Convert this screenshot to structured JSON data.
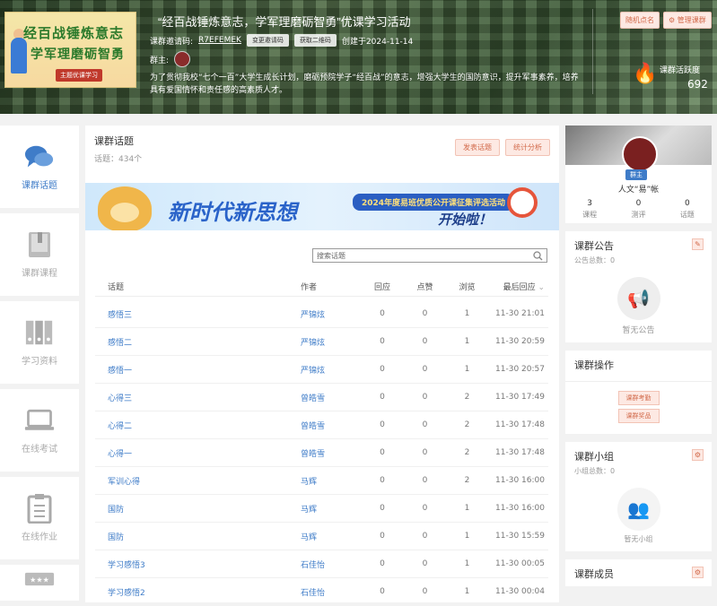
{
  "header": {
    "title": "“经百战锤炼意志，学军理磨砺智勇”优课学习活动",
    "invite_label": "课群邀请码:",
    "invite_code": "R7EFEMEK",
    "change_code_btn": "变更邀请码",
    "qr_btn": "获取二维码",
    "created": "创建于2024-11-14",
    "owner_label": "群主:",
    "description": "为了贯彻我校“七个一百”大学生成长计划，磨砺预院学子“经百战”的意志，增强大学生的国防意识，提升军事素养，培养具有爱国情怀和责任感的高素质人才。",
    "random_call_btn": "随机点名",
    "manage_btn": "管理课群",
    "activity_label": "课群活跃度",
    "activity_value": "692",
    "cover": {
      "line1": "经百战锤炼意志",
      "line2": "学军理磨砺智勇",
      "tag": "主题优课学习"
    }
  },
  "sidebar": {
    "items": [
      {
        "label": "课群话题"
      },
      {
        "label": "课群课程"
      },
      {
        "label": "学习资料"
      },
      {
        "label": "在线考试"
      },
      {
        "label": "在线作业"
      }
    ]
  },
  "main": {
    "title": "课群话题",
    "count": "话题：434个",
    "post_btn": "发表话题",
    "stats_btn": "统计分析",
    "banner": {
      "text1": "新时代新思想",
      "ribbon": "2024年度易班优质公开课征集评选活动",
      "sub": "开始啦！"
    },
    "search_placeholder": "搜索话题",
    "columns": {
      "topic": "话题",
      "author": "作者",
      "reply": "回应",
      "like": "点赞",
      "view": "浏览",
      "last": "最后回应"
    },
    "rows": [
      {
        "topic": "感悟三",
        "author": "严锦炫",
        "reply": "0",
        "like": "0",
        "view": "1",
        "last": "11-30 21:01"
      },
      {
        "topic": "感悟二",
        "author": "严锦炫",
        "reply": "0",
        "like": "0",
        "view": "1",
        "last": "11-30 20:59"
      },
      {
        "topic": "感悟一",
        "author": "严锦炫",
        "reply": "0",
        "like": "0",
        "view": "1",
        "last": "11-30 20:57"
      },
      {
        "topic": "心得三",
        "author": "曾皓雪",
        "reply": "0",
        "like": "0",
        "view": "2",
        "last": "11-30 17:49"
      },
      {
        "topic": "心得二",
        "author": "曾皓雪",
        "reply": "0",
        "like": "0",
        "view": "2",
        "last": "11-30 17:48"
      },
      {
        "topic": "心得一",
        "author": "曾皓雪",
        "reply": "0",
        "like": "0",
        "view": "2",
        "last": "11-30 17:48"
      },
      {
        "topic": "军训心得",
        "author": "马辉",
        "reply": "0",
        "like": "0",
        "view": "2",
        "last": "11-30 16:00"
      },
      {
        "topic": "国防",
        "author": "马辉",
        "reply": "0",
        "like": "0",
        "view": "1",
        "last": "11-30 16:00"
      },
      {
        "topic": "国防",
        "author": "马辉",
        "reply": "0",
        "like": "0",
        "view": "1",
        "last": "11-30 15:59"
      },
      {
        "topic": "学习感悟3",
        "author": "石佳怡",
        "reply": "0",
        "like": "0",
        "view": "1",
        "last": "11-30 00:05"
      },
      {
        "topic": "学习感悟2",
        "author": "石佳怡",
        "reply": "0",
        "like": "0",
        "view": "1",
        "last": "11-30 00:04"
      }
    ]
  },
  "right": {
    "profile": {
      "badge": "群主",
      "name": "人文“易”帐",
      "stats": [
        {
          "value": "3",
          "label": "课程"
        },
        {
          "value": "0",
          "label": "测评"
        },
        {
          "value": "0",
          "label": "话题"
        }
      ]
    },
    "notice": {
      "title": "课群公告",
      "sub": "公告总数：0",
      "empty": "暂无公告"
    },
    "ops": {
      "title": "课群操作",
      "btn1": "课群考勤",
      "btn2": "课群奖品"
    },
    "groups": {
      "title": "课群小组",
      "sub": "小组总数：0",
      "empty": "暂无小组"
    },
    "members": {
      "title": "课群成员"
    }
  }
}
